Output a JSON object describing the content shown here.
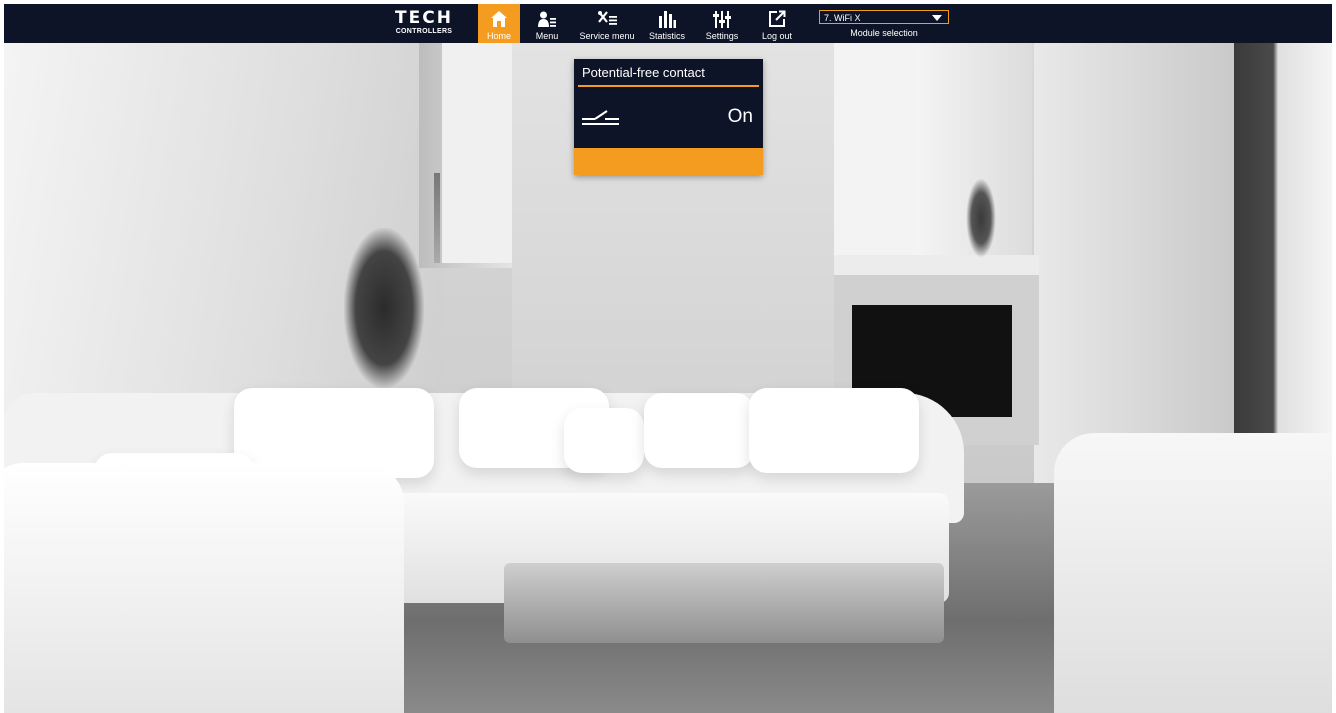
{
  "logo": {
    "main": "TECH",
    "sub": "CONTROLLERS"
  },
  "nav": [
    {
      "label": "Home",
      "icon": "home-icon",
      "active": true
    },
    {
      "label": "Menu",
      "icon": "user-menu-icon",
      "active": false
    },
    {
      "label": "Service menu",
      "icon": "tools-icon",
      "active": false
    },
    {
      "label": "Statistics",
      "icon": "bar-chart-icon",
      "active": false
    },
    {
      "label": "Settings",
      "icon": "sliders-icon",
      "active": false
    },
    {
      "label": "Log out",
      "icon": "logout-icon",
      "active": false
    }
  ],
  "module": {
    "selected": "7. WiFi X",
    "label": "Module selection"
  },
  "tile": {
    "title": "Potential-free contact",
    "value": "On",
    "icon": "contact-switch-icon"
  },
  "colors": {
    "navy": "#0e1428",
    "accent": "#f39c1f"
  }
}
